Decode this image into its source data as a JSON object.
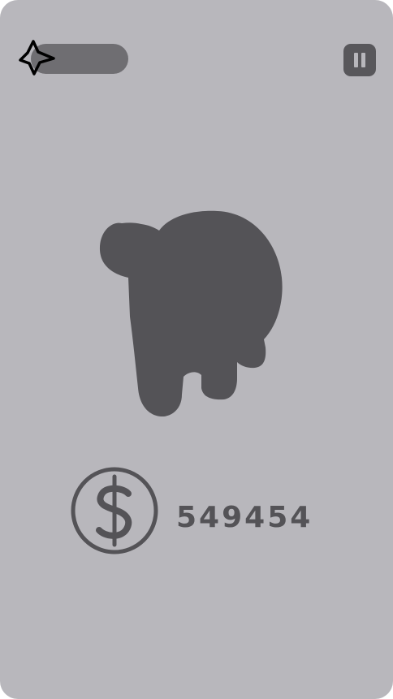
{
  "hud": {
    "star_icon": "star-outline-icon",
    "progress_fraction": 0.0,
    "pause_icon": "pause-icon"
  },
  "silhouette": {
    "icon": "mystery-creature-silhouette"
  },
  "coins": {
    "icon": "dollar-coin-icon",
    "amount": "549454"
  },
  "colors": {
    "background": "#b8b7bc",
    "foreground": "#545357",
    "progress_track": "#6f6e72"
  }
}
